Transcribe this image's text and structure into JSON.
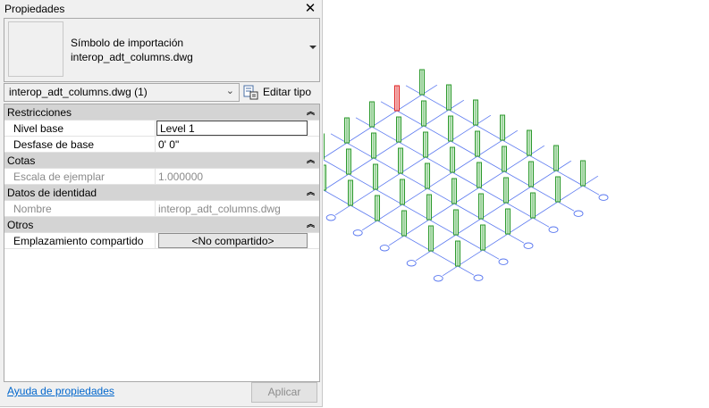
{
  "panel": {
    "title": "Propiedades",
    "close_icon": "close-icon",
    "type_selector": {
      "line1": "Símbolo de importación",
      "line2": "interop_adt_columns.dwg",
      "arrow_icon": "dropdown-arrow-icon"
    },
    "instance_filter": {
      "value": "interop_adt_columns.dwg (1)",
      "chevron_icon": "chevron-down-icon"
    },
    "edit_type": {
      "label": "Editar tipo",
      "icon": "edit-type-icon"
    },
    "sections": {
      "restricciones": {
        "label": "Restricciones",
        "collapse_icon": "collapse-icon",
        "rows": [
          {
            "key": "Nivel base",
            "value": "Level 1"
          },
          {
            "key": "Desfase de base",
            "value": "0'  0\""
          }
        ]
      },
      "cotas": {
        "label": "Cotas",
        "collapse_icon": "collapse-icon",
        "rows": [
          {
            "key": "Escala de ejemplar",
            "value": "1.000000"
          }
        ]
      },
      "identidad": {
        "label": "Datos de identidad",
        "collapse_icon": "collapse-icon",
        "rows": [
          {
            "key": "Nombre",
            "value": "interop_adt_columns.dwg"
          }
        ]
      },
      "otros": {
        "label": "Otros",
        "collapse_icon": "collapse-icon",
        "rows": [
          {
            "key": "Emplazamiento compartido",
            "value": "<No compartido>"
          }
        ]
      }
    },
    "help_link": "Ayuda de propiedades",
    "apply_button": "Aplicar"
  },
  "viewport": {
    "grid_color": "#5a78f0",
    "column_color": "#2e9a2e",
    "selected_column_color": "#e02020",
    "columns_per_row": 7,
    "column_rows": 6,
    "bubbles_per_side": 7
  }
}
